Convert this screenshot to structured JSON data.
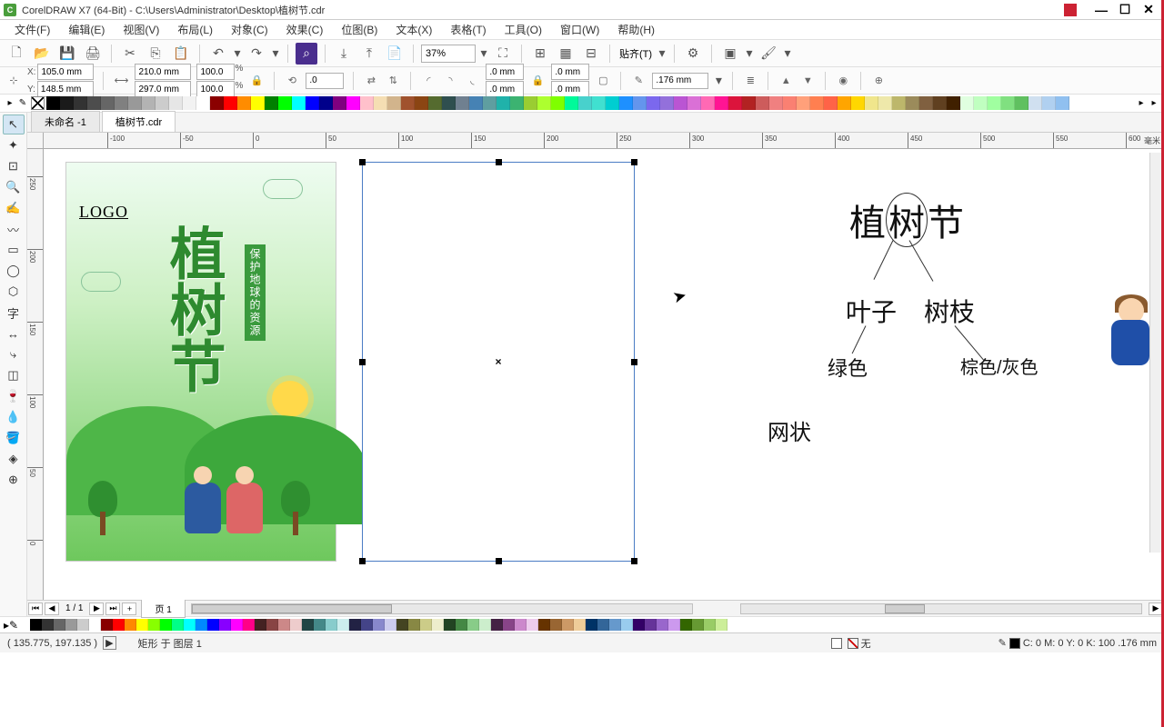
{
  "app": {
    "title": "CorelDRAW X7 (64-Bit) - C:\\Users\\Administrator\\Desktop\\植树节.cdr"
  },
  "menu": {
    "items": [
      "文件(F)",
      "编辑(E)",
      "视图(V)",
      "布局(L)",
      "对象(C)",
      "效果(C)",
      "位图(B)",
      "文本(X)",
      "表格(T)",
      "工具(O)",
      "窗口(W)",
      "帮助(H)"
    ]
  },
  "toolbar": {
    "zoom": "37%",
    "snap_label": "贴齐(T)"
  },
  "propbar": {
    "x_label": "X:",
    "x": "105.0 mm",
    "y_label": "Y:",
    "y": "148.5 mm",
    "w": "210.0 mm",
    "h": "297.0 mm",
    "sx": "100.0",
    "sy": "100.0",
    "pct": "%",
    "rot": ".0",
    "dim1": ".0 mm",
    "dim2": ".0 mm",
    "dim3": ".0 mm",
    "dim4": ".0 mm",
    "outline": ".176 mm"
  },
  "doctabs": {
    "tab1": "未命名 -1",
    "tab2": "植树节.cdr"
  },
  "ruler": {
    "h": [
      "-100",
      "-50",
      "0",
      "50",
      "100",
      "150",
      "200",
      "250",
      "300",
      "350",
      "400",
      "450",
      "500",
      "550",
      "600"
    ],
    "v": [
      "250",
      "200",
      "150",
      "100",
      "50",
      "0"
    ],
    "unit": "毫米"
  },
  "pages": {
    "count": "1 / 1",
    "tab": "页 1"
  },
  "thumb": {
    "logo": "LOGO",
    "title": "植树节",
    "subtitle": "保护地球的资源"
  },
  "mindmap": {
    "root_a": "植",
    "root_b": "树",
    "root_c": "节",
    "l2a": "叶子",
    "l2b": "树枝",
    "l3a": "绿色",
    "l3b": "棕色/灰色",
    "l4": "网状"
  },
  "status": {
    "coords": "( 135.775, 197.135 )",
    "object": "矩形 于 图层 1",
    "fill_label": "无",
    "color_info": "C: 0 M: 0 Y: 0 K: 100  .176 mm"
  },
  "palette_top": [
    "#000000",
    "#1a1a1a",
    "#333333",
    "#4d4d4d",
    "#666666",
    "#808080",
    "#999999",
    "#b3b3b3",
    "#cccccc",
    "#e6e6e6",
    "#f2f2f2",
    "#ffffff",
    "#8b0000",
    "#ff0000",
    "#ff8c00",
    "#ffff00",
    "#008000",
    "#00ff00",
    "#00ffff",
    "#0000ff",
    "#00008b",
    "#800080",
    "#ff00ff",
    "#ffc0cb",
    "#f5deb3",
    "#d2b48c",
    "#a0522d",
    "#8b4513",
    "#556b2f",
    "#2f4f4f",
    "#708090",
    "#4682b4",
    "#5f9ea0",
    "#20b2aa",
    "#3cb371",
    "#9acd32",
    "#adff2f",
    "#7fff00",
    "#00fa9a",
    "#48d1cc",
    "#40e0d0",
    "#00ced1",
    "#1e90ff",
    "#6495ed",
    "#7b68ee",
    "#9370db",
    "#ba55d3",
    "#da70d6",
    "#ff69b4",
    "#ff1493",
    "#dc143c",
    "#b22222",
    "#cd5c5c",
    "#f08080",
    "#fa8072",
    "#ffa07a",
    "#ff7f50",
    "#ff6347",
    "#ffa500",
    "#ffd700",
    "#f0e68c",
    "#eee8aa",
    "#bdb76b",
    "#9b8b5b",
    "#806040",
    "#604020",
    "#402000",
    "#e0ffe0",
    "#c0ffc0",
    "#a0ffa0",
    "#80e080",
    "#60c060",
    "#d0e0f0",
    "#b0d0f0",
    "#90c0f0"
  ],
  "palette_bottom": [
    "#000",
    "#333",
    "#666",
    "#999",
    "#ccc",
    "#fff",
    "#800",
    "#f00",
    "#f80",
    "#ff0",
    "#8f0",
    "#0f0",
    "#0f8",
    "#0ff",
    "#08f",
    "#00f",
    "#80f",
    "#f0f",
    "#f08",
    "#422",
    "#844",
    "#c88",
    "#ecc",
    "#244",
    "#488",
    "#8cc",
    "#cee",
    "#224",
    "#448",
    "#88c",
    "#cce",
    "#442",
    "#884",
    "#cc8",
    "#eec",
    "#242",
    "#484",
    "#8c8",
    "#cec",
    "#424",
    "#848",
    "#c8c",
    "#ece",
    "#630",
    "#963",
    "#c96",
    "#ec9",
    "#036",
    "#369",
    "#69c",
    "#9ce",
    "#306",
    "#639",
    "#96c",
    "#c9e",
    "#360",
    "#693",
    "#9c6",
    "#ce9"
  ]
}
